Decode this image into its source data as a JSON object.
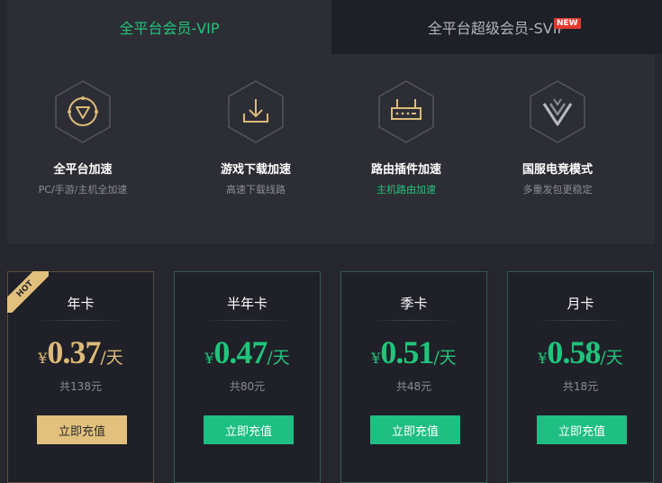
{
  "tabs": {
    "vip_label": "全平台会员-VIP",
    "svip_label": "全平台超级会员-SVIP",
    "new_badge": "NEW"
  },
  "features": [
    {
      "title": "全平台加速",
      "desc": "PC/手游/主机全加速",
      "icon": "platform-accelerate-icon"
    },
    {
      "title": "游戏下载加速",
      "desc": "高速下载线路",
      "icon": "download-icon"
    },
    {
      "title": "路由插件加速",
      "desc": "主机路由加速",
      "icon": "router-icon"
    },
    {
      "title": "国服电竞模式",
      "desc": "多重发包更稳定",
      "icon": "esports-v-icon"
    }
  ],
  "plans": [
    {
      "name": "年卡",
      "currency": "¥",
      "price": "0.37",
      "unit": "/天",
      "total": "共138元",
      "button": "立即充值",
      "hot": "HOT"
    },
    {
      "name": "半年卡",
      "currency": "¥",
      "price": "0.47",
      "unit": "/天",
      "total": "共80元",
      "button": "立即充值"
    },
    {
      "name": "季卡",
      "currency": "¥",
      "price": "0.51",
      "unit": "/天",
      "total": "共48元",
      "button": "立即充值"
    },
    {
      "name": "月卡",
      "currency": "¥",
      "price": "0.58",
      "unit": "/天",
      "total": "共18元",
      "button": "立即充值"
    }
  ],
  "colors": {
    "accent_green": "#20c47b",
    "accent_gold": "#e2c07d",
    "background": "#26272e",
    "new_badge": "#e23a2f"
  }
}
